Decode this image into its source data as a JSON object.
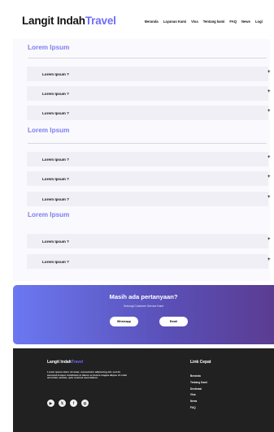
{
  "header": {
    "brand_main": "Langit Indah",
    "brand_accent": "Travel",
    "menu": [
      "Beranda",
      "Layanan Kami",
      "Visa",
      "Tentang kami",
      "FAQ",
      "News",
      "Logi"
    ]
  },
  "faq_sections": [
    {
      "title": "Lorem Ipsum",
      "questions": [
        "Lorem Ipsum ?",
        "Lorem Ipsum ?",
        "Lorem Ipsum ?"
      ]
    },
    {
      "title": "Lorem Ipsum",
      "questions": [
        "Lorem Ipsum ?",
        "Lorem Ipsum ?",
        "Lorem Ipsum ?"
      ]
    },
    {
      "title": "Lorem Ipsum",
      "questions": [
        "Lorem Ipsum ?",
        "Lorem Ipsum ?"
      ]
    }
  ],
  "expand_symbol": "+",
  "cta": {
    "title": "Masih ada pertanyaan?",
    "subtitle": "Hubungi Customer Service Kami",
    "whatsapp_label": "Whatsapp",
    "email_label": "Email"
  },
  "footer": {
    "brand_main": "Langit Indah",
    "brand_accent": "Travel",
    "description": "Lorem ipsum dolor sit amet, consectetur adipiscing elit, sed do eiusmod tempor incididunt ut labore et dolore magna aliqua. Ut enim ad minim veniam, quis nostrud exercitation.",
    "socials": [
      {
        "icon": "youtube-icon",
        "glyph": "▶"
      },
      {
        "icon": "x-icon",
        "glyph": "𝕏"
      },
      {
        "icon": "facebook-icon",
        "glyph": "f"
      },
      {
        "icon": "instagram-icon",
        "glyph": "◎"
      }
    ],
    "links_title": "Link Cepat",
    "links": [
      "Beranda",
      "Tentang Kami",
      "Destinasi",
      "Visa",
      "News",
      "FAQ"
    ]
  },
  "colors": {
    "accent": "#6f6cf6",
    "cta_gradient_start": "#6b78f2",
    "cta_gradient_end": "#5b3c92",
    "footer_bg": "#212121",
    "faq_row_bg": "#efeff5"
  }
}
